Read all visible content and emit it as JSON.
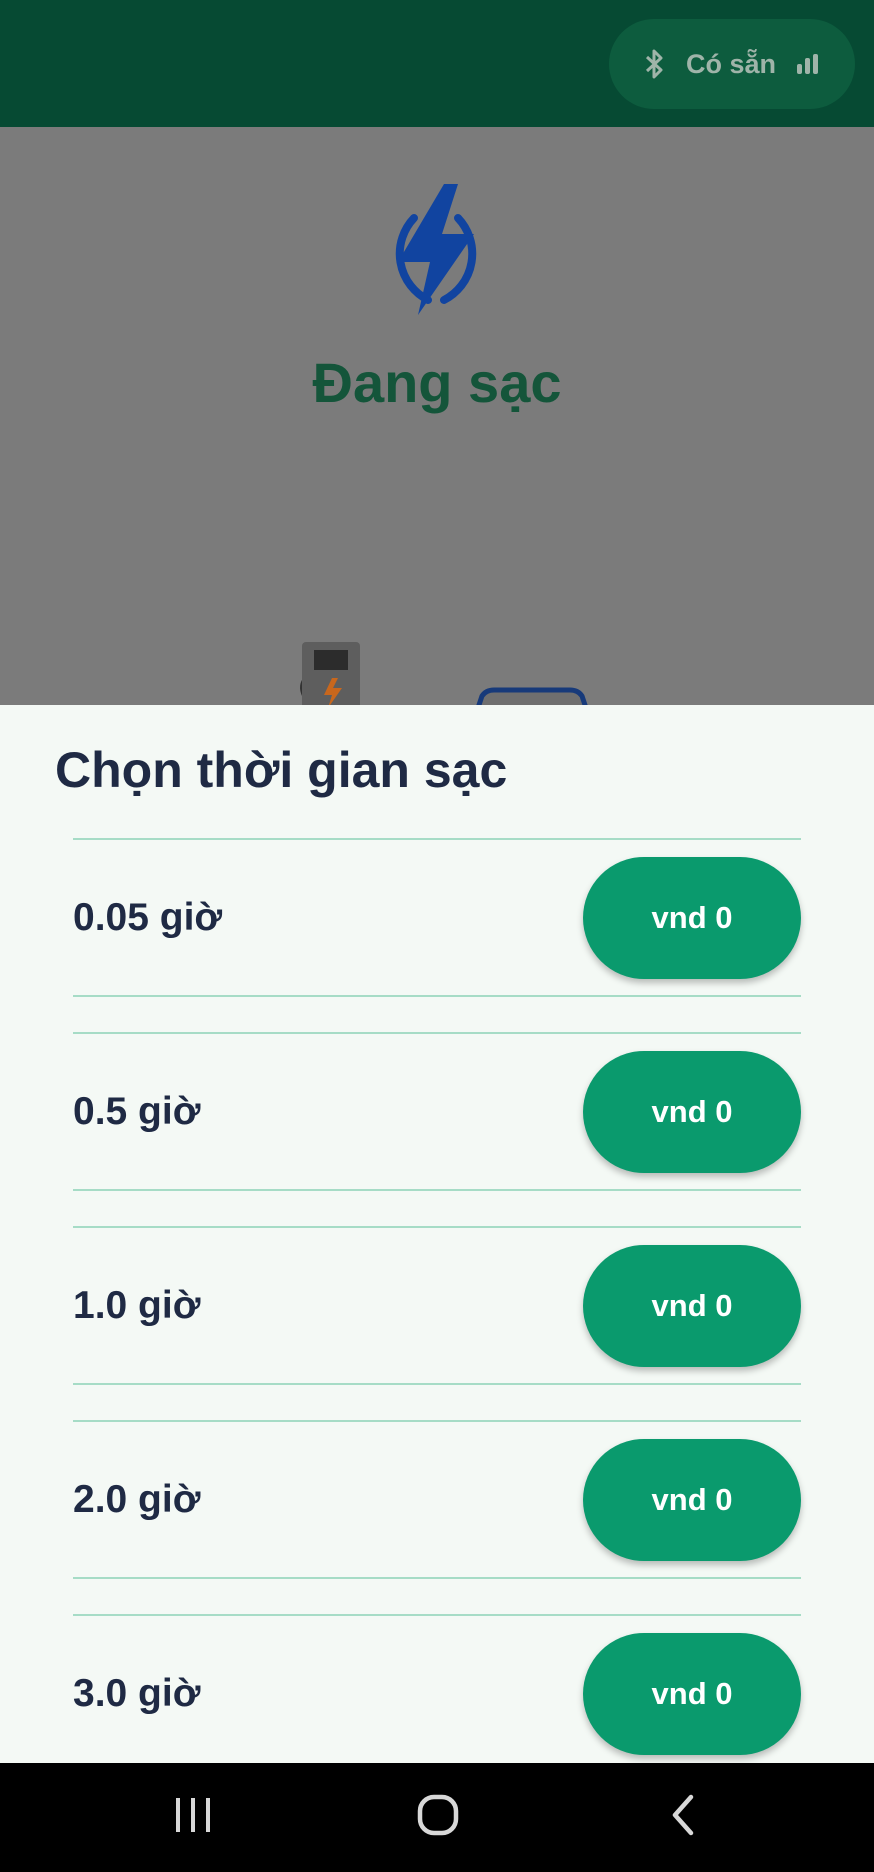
{
  "status": {
    "label": "Có sẵn",
    "bluetooth_icon": "bluetooth-icon",
    "signal_icon": "signal-bars-icon"
  },
  "main": {
    "icon": "lightning-bolt-icon",
    "title": "Đang sạc",
    "illustration": "charger-and-car-illustration"
  },
  "sheet": {
    "title": "Chọn thời gian sạc",
    "options": [
      {
        "label": "0.05 giờ",
        "price": "vnd 0"
      },
      {
        "label": "0.5 giờ",
        "price": "vnd 0"
      },
      {
        "label": "1.0 giờ",
        "price": "vnd 0"
      },
      {
        "label": "2.0 giờ",
        "price": "vnd 0"
      },
      {
        "label": "3.0 giờ",
        "price": "vnd 0"
      }
    ]
  },
  "nav": {
    "recents_icon": "recents-icon",
    "home_icon": "home-icon",
    "back_icon": "back-icon"
  },
  "colors": {
    "app_bar": "#064a33",
    "accent_green": "#0a9a6d",
    "title_green": "#14553a",
    "bolt_blue": "#1144a0",
    "text_dark": "#1f2a44",
    "divider": "#a6dcc6",
    "sheet_bg": "#f4f9f5"
  }
}
